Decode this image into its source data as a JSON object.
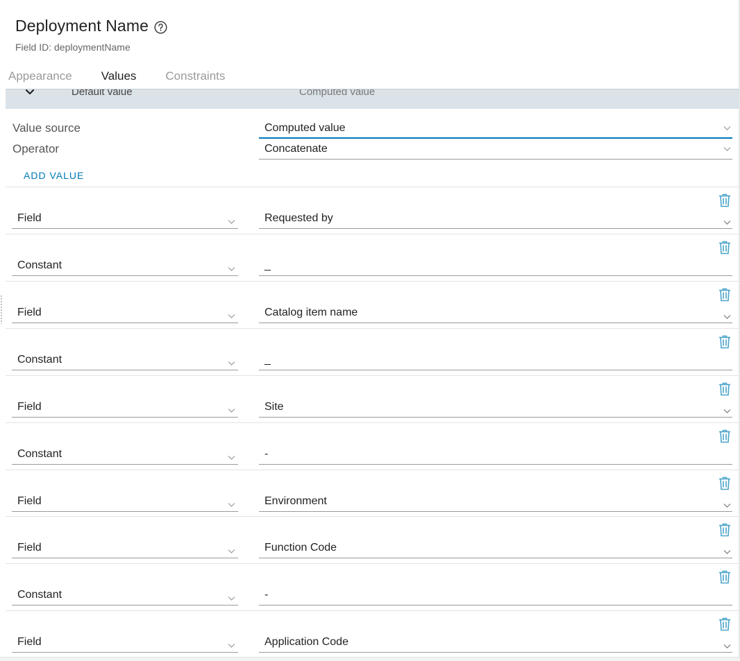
{
  "header": {
    "title": "Deployment Name",
    "field_id": "Field ID: deploymentName"
  },
  "tabs": [
    {
      "label": "Appearance",
      "active": false
    },
    {
      "label": "Values",
      "active": true
    },
    {
      "label": "Constraints",
      "active": false
    }
  ],
  "collapsed_section": {
    "label": "Default value",
    "summary": "Computed value"
  },
  "properties": {
    "value_source_label": "Value source",
    "value_source": "Computed value",
    "operator_label": "Operator",
    "operator": "Concatenate"
  },
  "add_value_label": "ADD VALUE",
  "rows": [
    {
      "type": "Field",
      "value": "Requested by",
      "value_is_select": true
    },
    {
      "type": "Constant",
      "value": "_",
      "value_is_select": false
    },
    {
      "type": "Field",
      "value": "Catalog item name",
      "value_is_select": true
    },
    {
      "type": "Constant",
      "value": "_",
      "value_is_select": false
    },
    {
      "type": "Field",
      "value": "Site",
      "value_is_select": true
    },
    {
      "type": "Constant",
      "value": "-",
      "value_is_select": false
    },
    {
      "type": "Field",
      "value": "Environment",
      "value_is_select": true
    },
    {
      "type": "Field",
      "value": "Function Code",
      "value_is_select": true
    },
    {
      "type": "Constant",
      "value": "-",
      "value_is_select": false
    },
    {
      "type": "Field",
      "value": "Application Code",
      "value_is_select": true
    }
  ],
  "icons": {
    "help": "help-circle-icon",
    "trash": "trash-icon",
    "chevron": "chevron-down-icon"
  },
  "colors": {
    "accent": "#0079b8",
    "trash": "#4aa3c9",
    "section_header_bg": "#dbe3e9"
  }
}
